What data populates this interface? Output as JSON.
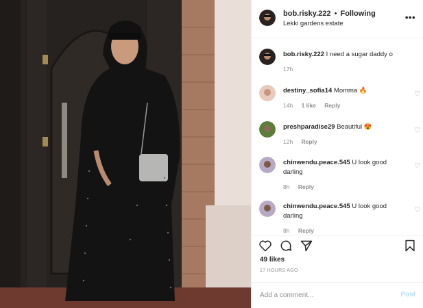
{
  "post": {
    "username": "bob.risky.222",
    "separator": "•",
    "follow_status": "Following",
    "location": "Lekki gardens estate",
    "more_icon": "more-options-icon",
    "caption": {
      "username": "bob.risky.222",
      "text": "I need a sugar daddy o",
      "time": "17h"
    },
    "comments": [
      {
        "username": "destiny_sofia14",
        "text": "Momma 🔥",
        "time": "14h",
        "likes": "1 like",
        "reply": "Reply"
      },
      {
        "username": "preshparadise29",
        "text": "Beautiful 😍",
        "time": "12h",
        "likes": "",
        "reply": "Reply"
      },
      {
        "username": "chinwendu.peace.545",
        "text": "U look good darling",
        "time": "8h",
        "likes": "",
        "reply": "Reply"
      },
      {
        "username": "chinwendu.peace.545",
        "text": "U look good darling",
        "time": "8h",
        "likes": "",
        "reply": "Reply"
      }
    ],
    "likes_count": "49 likes",
    "timestamp": "17 HOURS AGO",
    "add_comment_placeholder": "Add a comment...",
    "post_button": "Post"
  },
  "icons": {
    "like": "heart-icon",
    "comment": "comment-bubble-icon",
    "share": "share-paper-plane-icon",
    "save": "bookmark-icon"
  },
  "colors": {
    "text": "#262626",
    "muted": "#8e8e8e",
    "border": "#efefef",
    "post_disabled": "#b2dffc"
  }
}
